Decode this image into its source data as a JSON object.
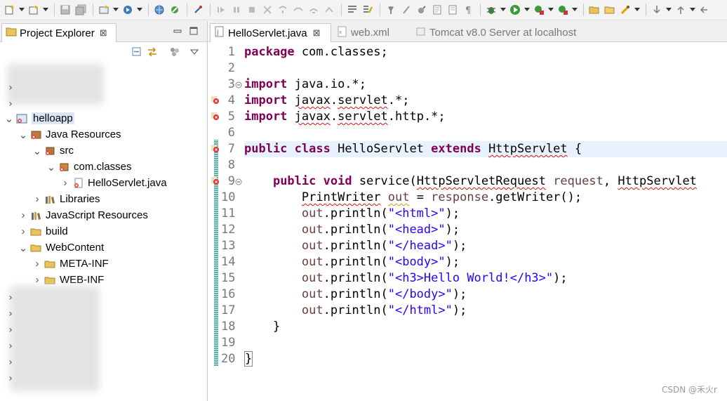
{
  "toolbar": {
    "items": [
      "new-file",
      "new-wizard",
      "save",
      "save-all",
      "new-server",
      "run-config",
      "globe",
      "external-tools",
      "pin",
      "resume",
      "suspend",
      "terminate",
      "disconnect",
      "step-into",
      "step-over",
      "step-return",
      "drop-to-frame",
      "use-step-filters",
      "debug-config",
      "coverage",
      "refresh",
      "open-type",
      "show-whitespace",
      "debug",
      "run",
      "run-external",
      "run-server",
      "open-folder",
      "open-project",
      "toggle-mark",
      "previous-annotation",
      "next-annotation",
      "back"
    ]
  },
  "project_explorer": {
    "tab_label": "Project Explorer",
    "tab_close": "⊠",
    "tree": [
      {
        "label": "helloapp",
        "icon": "web-project-icon",
        "level": 0,
        "expanded": true,
        "selected": true
      },
      {
        "label": "Java Resources",
        "icon": "java-resources-icon",
        "level": 1,
        "expanded": true
      },
      {
        "label": "src",
        "icon": "source-folder-icon",
        "level": 2,
        "expanded": true
      },
      {
        "label": "com.classes",
        "icon": "package-icon",
        "level": 3,
        "expanded": true
      },
      {
        "label": "HelloServlet.java",
        "icon": "java-file-error-icon",
        "level": 4,
        "expanded": null
      },
      {
        "label": "Libraries",
        "icon": "libraries-icon",
        "level": 3,
        "expanded": false
      },
      {
        "label": "JavaScript Resources",
        "icon": "javascript-resources-icon",
        "level": 1,
        "expanded": false
      },
      {
        "label": "build",
        "icon": "folder-icon",
        "level": 1,
        "expanded": false
      },
      {
        "label": "WebContent",
        "icon": "folder-icon",
        "level": 1,
        "expanded": true
      },
      {
        "label": "META-INF",
        "icon": "folder-icon",
        "level": 2,
        "expanded": false
      },
      {
        "label": "WEB-INF",
        "icon": "folder-icon",
        "level": 2,
        "expanded": false
      }
    ]
  },
  "editor": {
    "tabs": [
      {
        "label": "HelloServlet.java",
        "active": true,
        "close": "⊠"
      },
      {
        "label": "web.xml",
        "active": false
      },
      {
        "label": "Tomcat v8.0 Server at localhost",
        "active": false
      }
    ],
    "line_numbers": [
      "1",
      "2",
      "3",
      "4",
      "5",
      "6",
      "7",
      "8",
      "9",
      "10",
      "11",
      "12",
      "13",
      "14",
      "15",
      "16",
      "17",
      "18",
      "19",
      "20"
    ],
    "code": {
      "l1_kw": "package",
      "l1_rest": " com.classes;",
      "l3_kw": "import",
      "l3_rest": " java.io.*;",
      "l4_kw": "import",
      "l4_sp": " ",
      "l4_err": "javax",
      ".servlet.*;": "",
      "l4_mid": ".",
      "l4_err2": "servlet",
      "l4_end": ".*;",
      "l5_kw": "import",
      "l5_sp": " ",
      "l5_err": "javax",
      "l5_mid": ".",
      "l5_err2": "servlet",
      "l5_end": ".http.*;",
      "l7_kw1": "public",
      "l7_kw2": "class",
      "l7_name": " HelloServlet ",
      "l7_kw3": "extends",
      "l7_sp": " ",
      "l7_err": "HttpServlet",
      "l7_end": " {",
      "l9_kw1": "public",
      "l9_kw2": "void",
      "l9_name": " service(",
      "l9_err": "HttpServletRequest",
      "l9_sp": " ",
      "l9_var": "request",
      "l9_comma": ", ",
      "l9_err2": "HttpServlet",
      "l10_type": "PrintWriter",
      "l10_sp": " ",
      "l10_var": "out",
      "l10_eq": " = ",
      "l10_var2": "response",
      "l10_end": ".getWriter();",
      "l11_out": "out",
      "l11_mid": ".println(",
      "l11_str": "\"<html>\"",
      "l11_end": ");",
      "l12_out": "out",
      "l12_mid": ".println(",
      "l12_str": "\"<head>\"",
      "l12_end": ");",
      "l13_out": "out",
      "l13_mid": ".println(",
      "l13_str": "\"</head>\"",
      "l13_end": ");",
      "l14_out": "out",
      "l14_mid": ".println(",
      "l14_str": "\"<body>\"",
      "l14_end": ");",
      "l15_out": "out",
      "l15_mid": ".println(",
      "l15_str": "\"<h3>Hello World!</h3>\"",
      "l15_end": ");",
      "l16_out": "out",
      "l16_mid": ".println(",
      "l16_str": "\"</body>\"",
      "l16_end": ");",
      "l17_out": "out",
      "l17_mid": ".println(",
      "l17_str": "\"</html>\"",
      "l17_end": ");",
      "l18": "}",
      "l20": "}"
    }
  },
  "watermark": "CSDN @禾火r",
  "colors": {
    "keyword": "#7f0055",
    "string": "#2a00ff",
    "variable": "#6a3e3e",
    "error": "#d11111",
    "selection": "#dbe7f7",
    "current_line": "#e8f2fe"
  }
}
